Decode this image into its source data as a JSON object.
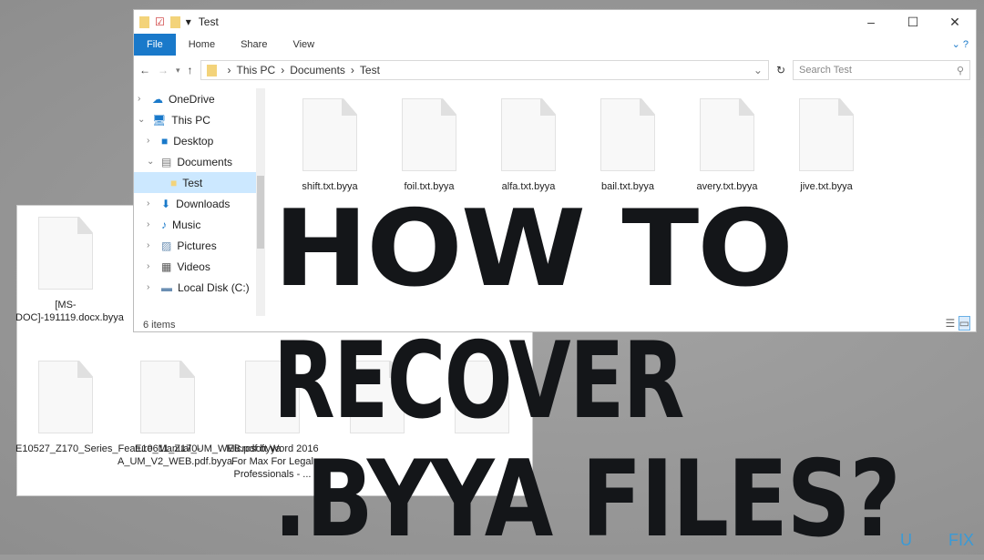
{
  "front_window": {
    "title": "Test",
    "window_buttons": [
      "–",
      "☐",
      "✕"
    ],
    "ribbon_tabs": [
      "File",
      "Home",
      "Share",
      "View"
    ],
    "breadcrumb": [
      "This PC",
      "Documents",
      "Test"
    ],
    "search_placeholder": "Search Test",
    "nav": [
      {
        "label": "OneDrive",
        "icon": "cloud-icon",
        "level": 0
      },
      {
        "label": "This PC",
        "icon": "computer-icon",
        "level": 0
      },
      {
        "label": "Desktop",
        "icon": "desktop-icon",
        "level": 1
      },
      {
        "label": "Documents",
        "icon": "documents-icon",
        "level": 1
      },
      {
        "label": "Test",
        "icon": "folder-icon",
        "level": 2,
        "selected": true
      },
      {
        "label": "Downloads",
        "icon": "download-icon",
        "level": 1
      },
      {
        "label": "Music",
        "icon": "music-icon",
        "level": 1
      },
      {
        "label": "Pictures",
        "icon": "pictures-icon",
        "level": 1
      },
      {
        "label": "Videos",
        "icon": "videos-icon",
        "level": 1
      },
      {
        "label": "Local Disk (C:)",
        "icon": "disk-icon",
        "level": 1
      }
    ],
    "files": [
      "shift.txt.byya",
      "foil.txt.byya",
      "alfa.txt.byya",
      "bail.txt.byya",
      "avery.txt.byya",
      "jive.txt.byya"
    ],
    "status": "6 items"
  },
  "back_window": {
    "files": [
      "[MS-DOC]-191119.docx.byya",
      "E10527_Z170_Series_Feature_Manual_UM_WEB.pdf.byya",
      "E10611_Z170-A_UM_V2_WEB.pdf.byya",
      "Microsoft Word 2016 For Max For Legal Professionals - ..."
    ]
  },
  "headline": [
    "HOW TO",
    "RECOVER",
    ".BYYA FILES?"
  ],
  "watermark": {
    "left": "U",
    "right": "FIX",
    "color": "#3a9ad6"
  },
  "colors": {
    "accent": "#1979ca",
    "headline": "#141619",
    "background": "#9a9a9a"
  }
}
